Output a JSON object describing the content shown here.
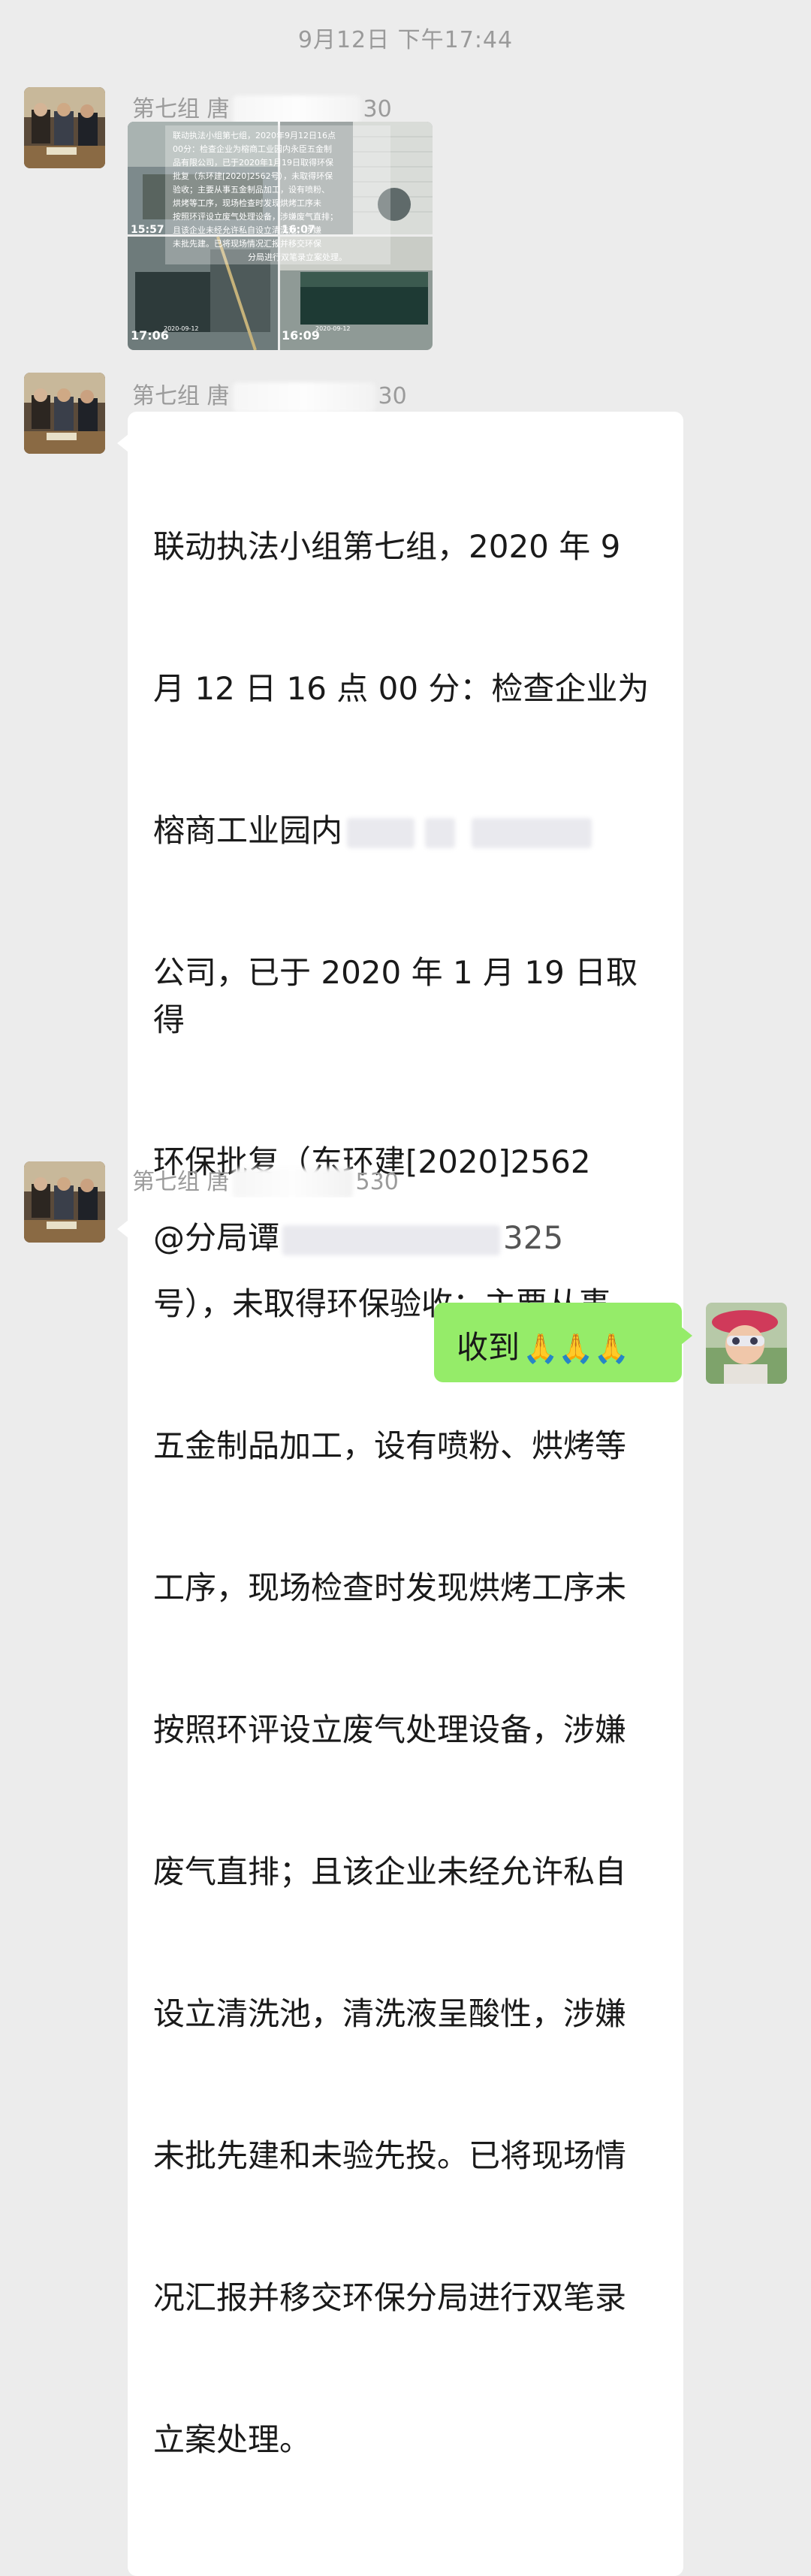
{
  "chat": {
    "timestamp": "9月12日 下午17:44",
    "messages": [
      {
        "sender_prefix": "第七组 唐",
        "sender_suffix": "30",
        "type": "image",
        "image": {
          "overlay_text": "联动执法小组第七组，2020年9月12日16点00分：检查企业为榕商工业园内永臣五金制品有限公司，已于2020年1月19日取得环保批复（东环建[2020]2562号），未取得环保验收；主要从事五金制品加工，设有喷粉、烘烤等工序，现场检查时发现烘烤工序未按照环评设立废气处理设备，涉嫌废气直排；且该企业未经允许私自设立清洗池，清洗液呈酸性，涉嫌未批先建和未验先投。已将现场情况汇报并移交环保分局进行双笔录立案处理。",
          "time_tl": "15:57",
          "time_tr": "16:07",
          "time_bl": "17:06",
          "time_br": "16:09",
          "date_bl": "2020-09-12",
          "date_br": "2020-09-12"
        }
      },
      {
        "sender_prefix": "第七组 唐",
        "sender_suffix": "30",
        "type": "text",
        "text_lines": [
          "联动执法小组第七组，2020 年 9",
          "月 12 日 16 点 00 分：检查企业为",
          "榕商工业园内",
          "公司，已于 2020 年 1 月 19 日取得",
          "环保批复（东环建[2020]2562",
          "号），未取得环保验收；主要从事",
          "五金制品加工，设有喷粉、烘烤等",
          "工序，现场检查时发现烘烤工序未",
          "按照环评设立废气处理设备，涉嫌",
          "废气直排；且该企业未经允许私自",
          "设立清洗池，清洗液呈酸性，涉嫌",
          "未批先建和未验先投。已将现场情",
          "况汇报并移交环保分局进行双笔录",
          "立案处理。"
        ]
      },
      {
        "sender_prefix": "第七组 唐",
        "sender_suffix": "530",
        "type": "text",
        "text_prefix": "@分局谭",
        "text_suffix": "325"
      },
      {
        "self": true,
        "type": "text",
        "text": "收到",
        "emoji": "🙏🙏🙏",
        "emoji_name": "pray-emoji"
      }
    ]
  },
  "colors": {
    "background": "#ececec",
    "bubble_in": "#ffffff",
    "bubble_out": "#95ec69",
    "meta_text": "#9b9b9b"
  }
}
